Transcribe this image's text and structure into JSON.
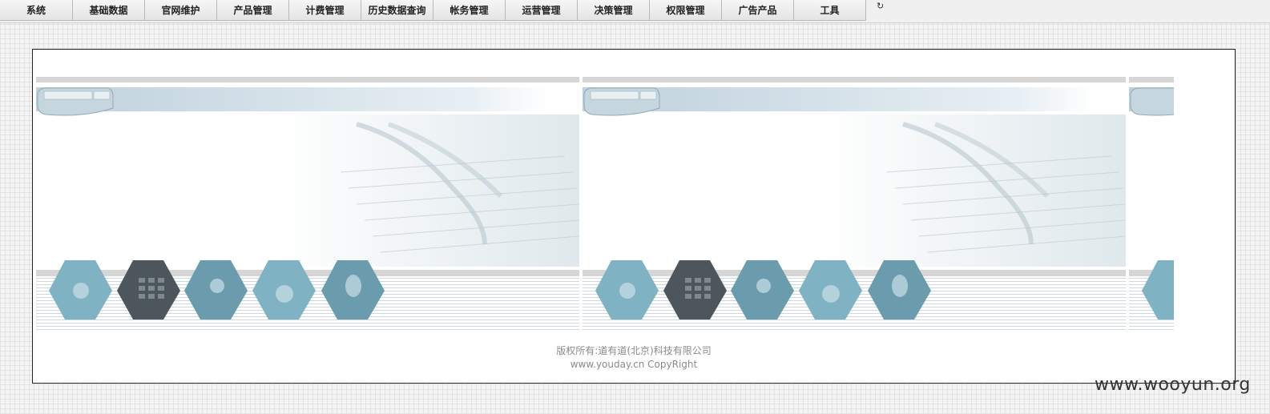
{
  "menu": {
    "items": [
      {
        "label": "系统"
      },
      {
        "label": "基础数据"
      },
      {
        "label": "官网维护"
      },
      {
        "label": "产品管理"
      },
      {
        "label": "计费管理"
      },
      {
        "label": "历史数据查询"
      },
      {
        "label": "帐务管理"
      },
      {
        "label": "运营管理"
      },
      {
        "label": "决策管理"
      },
      {
        "label": "权限管理"
      },
      {
        "label": "广告产品"
      },
      {
        "label": "工具"
      }
    ],
    "refresh_icon": "refresh-icon"
  },
  "footer": {
    "copyright": "版权所有:道有道(北京)科技有限公司",
    "site": "www.youday.cn CopyRight"
  },
  "watermark": "www.wooyun.org",
  "colors": {
    "accent": "#5f9aaa",
    "dark_hex": "#4a5258",
    "band": "#d8e3ea"
  }
}
